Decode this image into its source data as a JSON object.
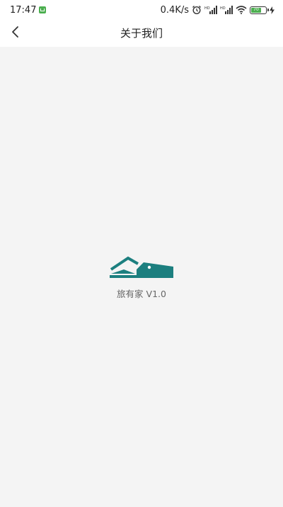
{
  "status_bar": {
    "time": "17:47",
    "network_speed": "0.4K/s",
    "battery_level": "70",
    "icons": [
      "notification-icon",
      "alarm-icon",
      "signal-hd-icon",
      "signal-icon",
      "wifi-icon",
      "battery-icon",
      "charging-icon"
    ]
  },
  "nav": {
    "title": "关于我们",
    "back_icon": "chevron-left-icon"
  },
  "about": {
    "logo_icon": "house-logo-icon",
    "app_name": "旅有家",
    "version": "V1.0",
    "version_text": "旅有家 V1.0"
  },
  "colors": {
    "brand": "#1c7f7f",
    "background": "#f4f4f4",
    "bar": "#ffffff"
  }
}
